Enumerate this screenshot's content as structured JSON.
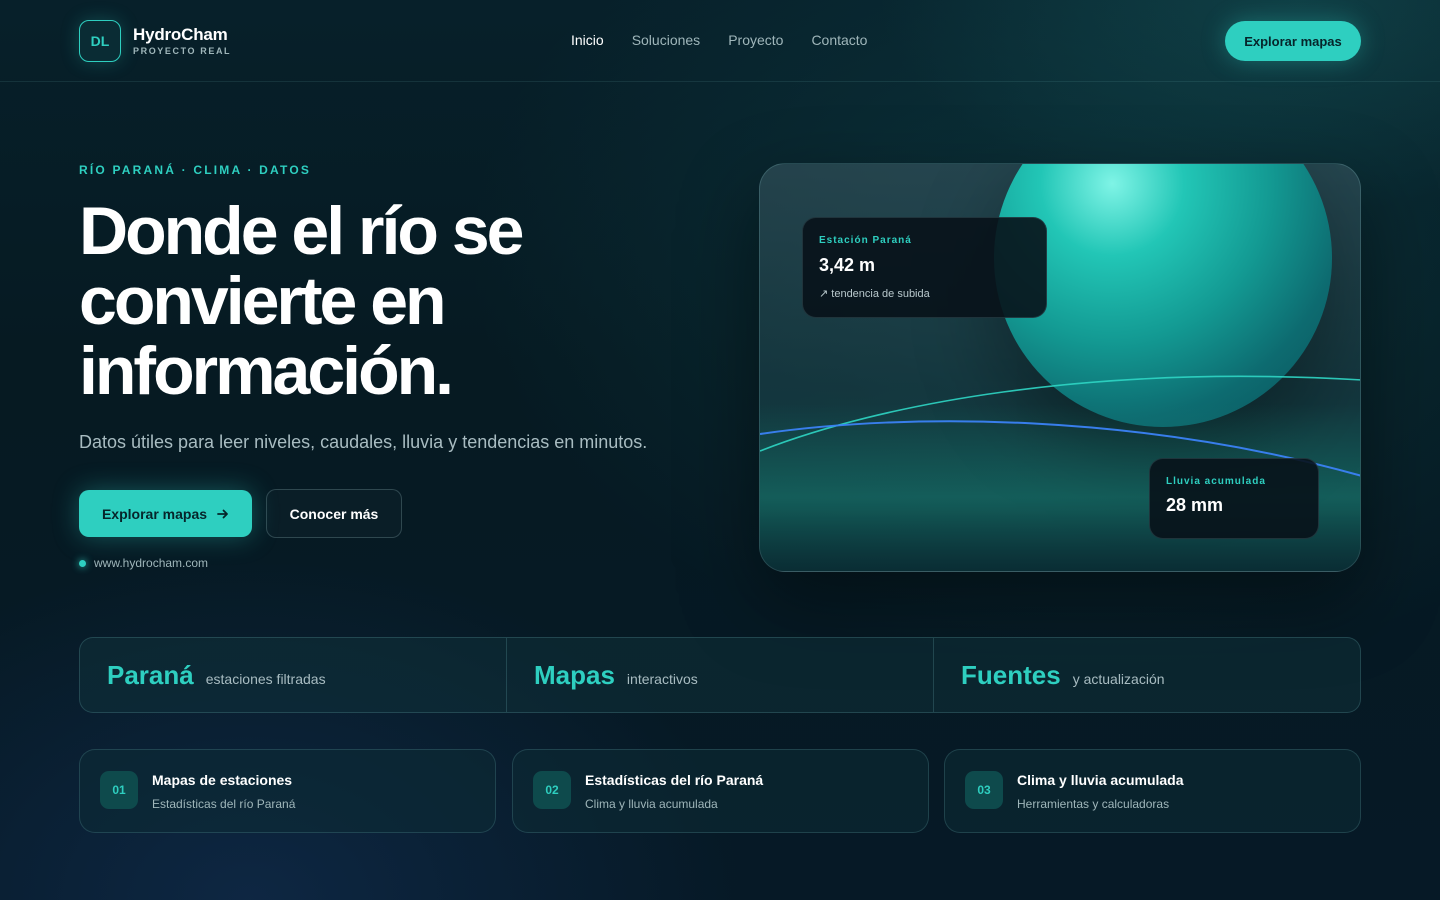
{
  "brand": {
    "logo": "DL",
    "name": "HydroCham",
    "tagline": "PROYECTO REAL"
  },
  "nav": {
    "items": [
      "Inicio",
      "Soluciones",
      "Proyecto",
      "Contacto"
    ],
    "active": "Inicio"
  },
  "header_cta": "Explorar mapas",
  "hero": {
    "eyebrow": "RÍO PARANÁ · CLIMA · DATOS",
    "headline": [
      "Donde el río se",
      "convierte en",
      "información."
    ],
    "lead": "Datos útiles para leer niveles, caudales, lluvia y tendencias en minutos.",
    "primary_cta": "Explorar mapas",
    "primary_cta_icon": "arrow-right-icon",
    "secondary_cta": "Conocer más",
    "url": "www.hydrocham.com"
  },
  "visual": {
    "station": {
      "label": "Estación Paraná",
      "value": "3,42 m",
      "trend": "↗ tendencia de subida"
    },
    "rain": {
      "label": "Lluvia acumulada",
      "value": "28 mm"
    }
  },
  "metrics": [
    {
      "big": "Paraná",
      "small": "estaciones filtradas"
    },
    {
      "big": "Mapas",
      "small": "interactivos"
    },
    {
      "big": "Fuentes",
      "small": "y actualización"
    }
  ],
  "features": [
    {
      "num": "01",
      "title": "Mapas de estaciones",
      "subtitle": "Estadísticas del río Paraná"
    },
    {
      "num": "02",
      "title": "Estadísticas del río Paraná",
      "subtitle": "Clima y lluvia acumulada"
    },
    {
      "num": "03",
      "title": "Clima y lluvia acumulada",
      "subtitle": "Herramientas y calculadoras"
    }
  ],
  "colors": {
    "accent": "#2ecfc0",
    "background": "#07202a",
    "wave_blue": "#3b82f6"
  }
}
